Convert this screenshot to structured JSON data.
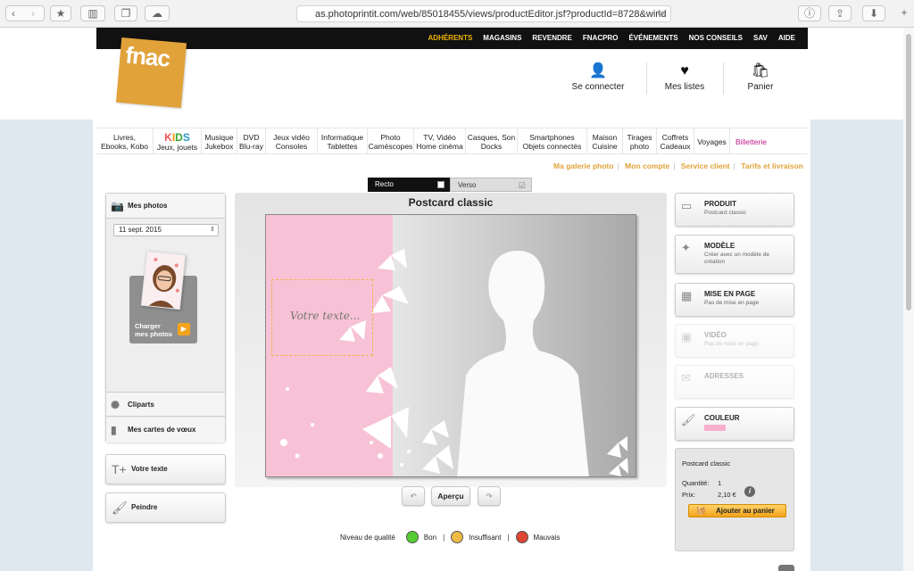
{
  "browser": {
    "url": "as.photoprintit.com/web/85018455/views/productEditor.jsf?productId=8728&wind",
    "icons": [
      "back-icon",
      "forward-icon",
      "bookmarks-icon",
      "sidebar-icon",
      "tabs-icon",
      "cloud-icon",
      "reload-icon",
      "info-icon",
      "share-icon",
      "download-icon",
      "new-tab-icon"
    ]
  },
  "topnav": {
    "items": [
      "ADHÉRENTS",
      "MAGASINS",
      "REVENDRE",
      "FNACPRO",
      "ÉVÉNEMENTS",
      "NOS CONSEILS",
      "SAV",
      "AIDE"
    ]
  },
  "logo": {
    "text": "fnac"
  },
  "account": {
    "login": "Se connecter",
    "lists": "Mes listes",
    "cart": "Panier"
  },
  "categories": [
    {
      "l1": "Livres,",
      "l2": "Ebooks, Kobo"
    },
    {
      "kids": "KIDS",
      "l2": "Jeux, jouets"
    },
    {
      "l1": "Musique",
      "l2": "Jukebox"
    },
    {
      "l1": "DVD",
      "l2": "Blu-ray"
    },
    {
      "l1": "Jeux vidéo",
      "l2": "Consoles"
    },
    {
      "l1": "Informatique",
      "l2": "Tablettes"
    },
    {
      "l1": "Photo",
      "l2": "Caméscopes"
    },
    {
      "l1": "TV, Vidéo",
      "l2": "Home cinéma"
    },
    {
      "l1": "Casques, Son",
      "l2": "Docks"
    },
    {
      "l1": "Smartphones",
      "l2": "Objets connectés"
    },
    {
      "l1": "Maison",
      "l2": "Cuisine"
    },
    {
      "l1": "Tirages",
      "l2": "photo"
    },
    {
      "l1": "Coffrets",
      "l2": "Cadeaux"
    },
    {
      "l1": "Voyages"
    },
    {
      "l1": "Billetterie"
    }
  ],
  "sublinks": [
    "Ma galerie photo",
    "Mon compte",
    "Service client",
    "Tarifs et livraison"
  ],
  "tabs": {
    "recto": "Recto",
    "verso": "Verso"
  },
  "left": {
    "photos_title": "Mes photos",
    "date": "11 sept. 2015",
    "load_line1": "Charger",
    "load_line2": "mes photos",
    "cliparts": "Cliparts",
    "cards": "Mes cartes de vœux",
    "text": "Votre texte",
    "paint": "Peindre"
  },
  "editor": {
    "title": "Postcard classic",
    "placeholder": "Votre texte...",
    "preview": "Aperçu"
  },
  "quality": {
    "label": "Niveau de qualité",
    "good": "Bon",
    "fair": "Insuffisant",
    "bad": "Mauvais"
  },
  "right": {
    "produit": {
      "title": "PRODUIT",
      "desc": "Postcard classic"
    },
    "modele": {
      "title": "MODÈLE",
      "desc": "Créer avec un modèle de création"
    },
    "mise": {
      "title": "MISE EN PAGE",
      "desc": "Pas de mise en page"
    },
    "video": {
      "title": "VIDÉO",
      "desc": "Pas de mise en page"
    },
    "adresses": {
      "title": "ADRESSES"
    },
    "couleur": {
      "title": "COULEUR",
      "swatch_color": "#f7b0cc"
    }
  },
  "summary": {
    "product": "Postcard classic",
    "qty_label": "Quantité:",
    "qty": "1",
    "price_label": "Prix:",
    "price": "2,10 €",
    "add": "Ajouter au panier"
  },
  "colors": {
    "brand": "#e1a23a",
    "accent": "#f3a31c",
    "pink": "#f7c2d6"
  }
}
